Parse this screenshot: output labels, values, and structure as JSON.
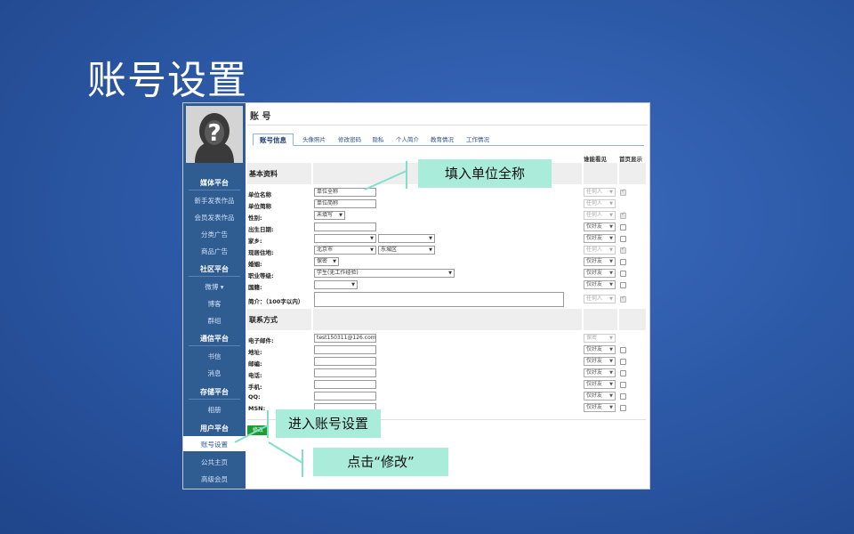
{
  "slide": {
    "title": "账号设置"
  },
  "callouts": {
    "unit": "填入单位全称",
    "settings": "进入账号设置",
    "modify": "点击“修改”"
  },
  "sidebar": {
    "groups": [
      {
        "label": "媒体平台",
        "items": [
          "新手发表作品",
          "会员发表作品",
          "分类广告",
          "商品广告"
        ]
      },
      {
        "label": "社区平台",
        "items": [
          "微博 ▾",
          "博客",
          "群组"
        ]
      },
      {
        "label": "通信平台",
        "items": [
          "书信",
          "消息"
        ]
      },
      {
        "label": "存储平台",
        "items": [
          "相册"
        ]
      },
      {
        "label": "用户平台",
        "items": [
          "账号设置",
          "公共主页",
          "高级会员"
        ]
      }
    ]
  },
  "main": {
    "title": "账 号",
    "tabs": [
      "账号信息",
      "头像照片",
      "修改密码",
      "隐私",
      "个人简介",
      "教育情况",
      "工作情况"
    ],
    "col_visible": "谁能看见",
    "col_home": "首页显示",
    "sections": {
      "basic": "基本资料",
      "contact": "联系方式"
    },
    "basic_fields": [
      {
        "label": "单位名称",
        "value": "单位全称",
        "vis": "任何人"
      },
      {
        "label": "单位简称",
        "value": "单位简称",
        "vis": "任何人"
      },
      {
        "label": "性别:",
        "value": "未填写",
        "vis": "任何人"
      },
      {
        "label": "出生日期:",
        "value": "",
        "vis": "仅好友"
      },
      {
        "label": "家乡:",
        "value": "",
        "vis": "仅好友"
      },
      {
        "label": "现居住地:",
        "value": "北京市",
        "value2": "东城区",
        "vis": "任何人"
      },
      {
        "label": "婚姻:",
        "value": "保密",
        "vis": "仅好友"
      },
      {
        "label": "职业等级:",
        "value": "学生(无工作经验)",
        "vis": "仅好友"
      },
      {
        "label": "国籍:",
        "value": "",
        "vis": "仅好友"
      },
      {
        "label": "简介：（100字以内）",
        "value": "",
        "vis": "任何人"
      }
    ],
    "contact_fields": [
      {
        "label": "电子邮件:",
        "value": "test150311@126.com",
        "vis": "保密"
      },
      {
        "label": "地址:",
        "value": "",
        "vis": "仅好友"
      },
      {
        "label": "邮编:",
        "value": "",
        "vis": "仅好友"
      },
      {
        "label": "电话:",
        "value": "",
        "vis": "仅好友"
      },
      {
        "label": "手机:",
        "value": "",
        "vis": "仅好友"
      },
      {
        "label": "QQ:",
        "value": "",
        "vis": "仅好友"
      },
      {
        "label": "MSN:",
        "value": "",
        "vis": "仅好友"
      }
    ],
    "save_label": "修改"
  }
}
